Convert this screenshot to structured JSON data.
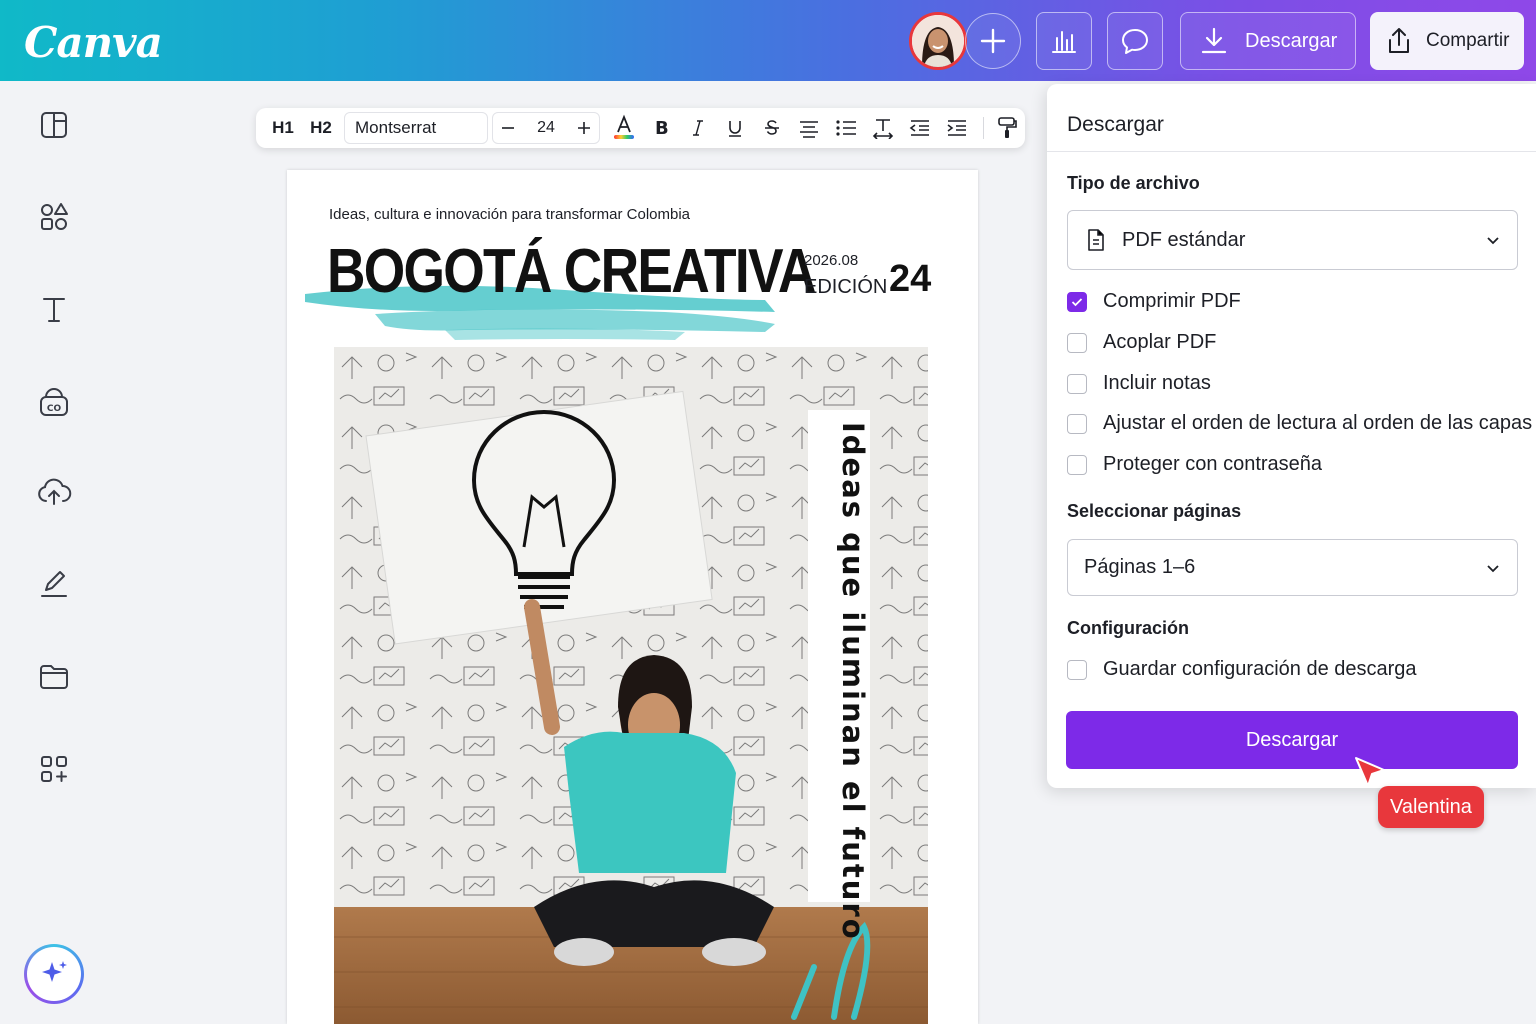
{
  "app": {
    "logo": "Canva"
  },
  "topbar": {
    "download_label": "Descargar",
    "share_label": "Compartir",
    "icons": [
      "plus-icon",
      "chart-icon",
      "comment-icon",
      "download-icon",
      "share-icon"
    ]
  },
  "sidebar": {
    "icons": [
      "layout-icon",
      "elements-icon",
      "text-icon",
      "brand-icon",
      "uploads-icon",
      "draw-icon",
      "projects-icon",
      "apps-icon",
      "magic-icon"
    ]
  },
  "text_toolbar": {
    "h1": "H1",
    "h2": "H2",
    "font": "Montserrat",
    "size": "24"
  },
  "page": {
    "tagline": "Ideas, cultura e innovación para transformar Colombia",
    "title": "BOGOTÁ CREATIVA",
    "edition_date": "2026.08",
    "edition_label": "EDICIÓN",
    "edition_number": "24",
    "vertical_text": "Ideas que iluminan el futuro"
  },
  "download_panel": {
    "title": "Descargar",
    "file_type_label": "Tipo de archivo",
    "file_type_value": "PDF estándar",
    "options": [
      {
        "label": "Comprimir PDF",
        "checked": true
      },
      {
        "label": "Acoplar PDF",
        "checked": false
      },
      {
        "label": "Incluir notas",
        "checked": false
      },
      {
        "label": "Ajustar el orden de lectura al orden de las capas",
        "checked": false
      },
      {
        "label": "Proteger con contraseña",
        "checked": false
      }
    ],
    "pages_label": "Seleccionar páginas",
    "pages_value": "Páginas 1–6",
    "config_label": "Configuración",
    "save_config_label": "Guardar configuración de descarga",
    "save_config_checked": false,
    "download_button": "Descargar"
  },
  "collaborator": {
    "name": "Valentina",
    "color": "#e8373c"
  },
  "colors": {
    "accent": "#7d2ae8",
    "turquoise": "#3fc2c4"
  }
}
